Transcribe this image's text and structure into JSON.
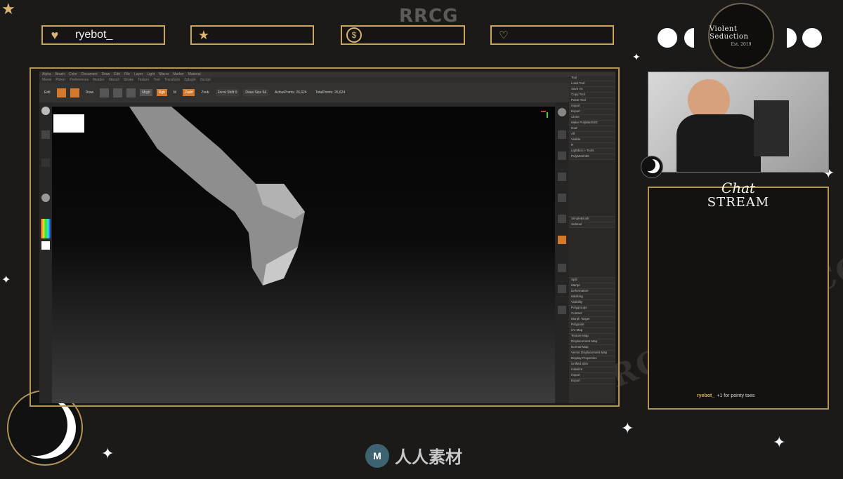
{
  "overlay": {
    "brand": "RRCG",
    "logo_text": "Violent Seduction",
    "logo_sub": "Est. 2019",
    "alerts": [
      {
        "icon": "heart-icon",
        "label": "ryebot_"
      },
      {
        "icon": "star-icon",
        "label": ""
      },
      {
        "icon": "dollar-icon",
        "label": ""
      },
      {
        "icon": "hand-heart-icon",
        "label": ""
      }
    ],
    "chat": {
      "title_script": "Chat",
      "title": "STREAM",
      "messages": [
        {
          "user": "ryebot_",
          "text": "+1 for pointy toes"
        }
      ]
    },
    "footer_text": "人人素材",
    "footer_logo": "M"
  },
  "app": {
    "menu_items": [
      "Alpha",
      "Brush",
      "Color",
      "Document",
      "Draw",
      "Edit",
      "File",
      "Layer",
      "Light",
      "Macro",
      "Marker",
      "Material",
      "Movie",
      "Picker",
      "Preferences",
      "Render",
      "Stencil",
      "Stroke",
      "Texture",
      "Tool",
      "Transform",
      "Zplugin",
      "Zscript"
    ],
    "toolbar": {
      "buttons": [
        "Edit",
        "Draw",
        "Move",
        "Scale",
        "Rotate"
      ],
      "mrgb": "Mrgb",
      "rgb": "Rgb",
      "m": "M",
      "zadd": "Zadd",
      "zsub": "Zsub",
      "focal_shift": "Focal Shift 0",
      "draw_size": "Draw Size 64",
      "active_points": "ActivePoints: 26,624",
      "total_points": "TotalPoints: 26,624"
    },
    "tool_panel": [
      "Tool",
      "Load Tool",
      "Save As",
      "Copy Tool",
      "Paste Tool",
      "Import",
      "Export",
      "Clone",
      "Make PolyMesh3D",
      "GoZ",
      "All",
      "Visible",
      "R",
      "Lightbox > Tools",
      "PolyMesh3D",
      "SimpleBrush",
      "Subtool",
      "Split",
      "Merge",
      "Deformation",
      "Masking",
      "Visibility",
      "Polygroups",
      "Contact",
      "Morph Target",
      "Polypaint",
      "UV Map",
      "Texture Map",
      "Displacement Map",
      "Normal Map",
      "Vector Displacement Map",
      "Display Properties",
      "Unified Skin",
      "Initialize",
      "Import",
      "Export"
    ],
    "colors": {
      "accent": "#d4782c",
      "frame": "#b59458"
    }
  }
}
